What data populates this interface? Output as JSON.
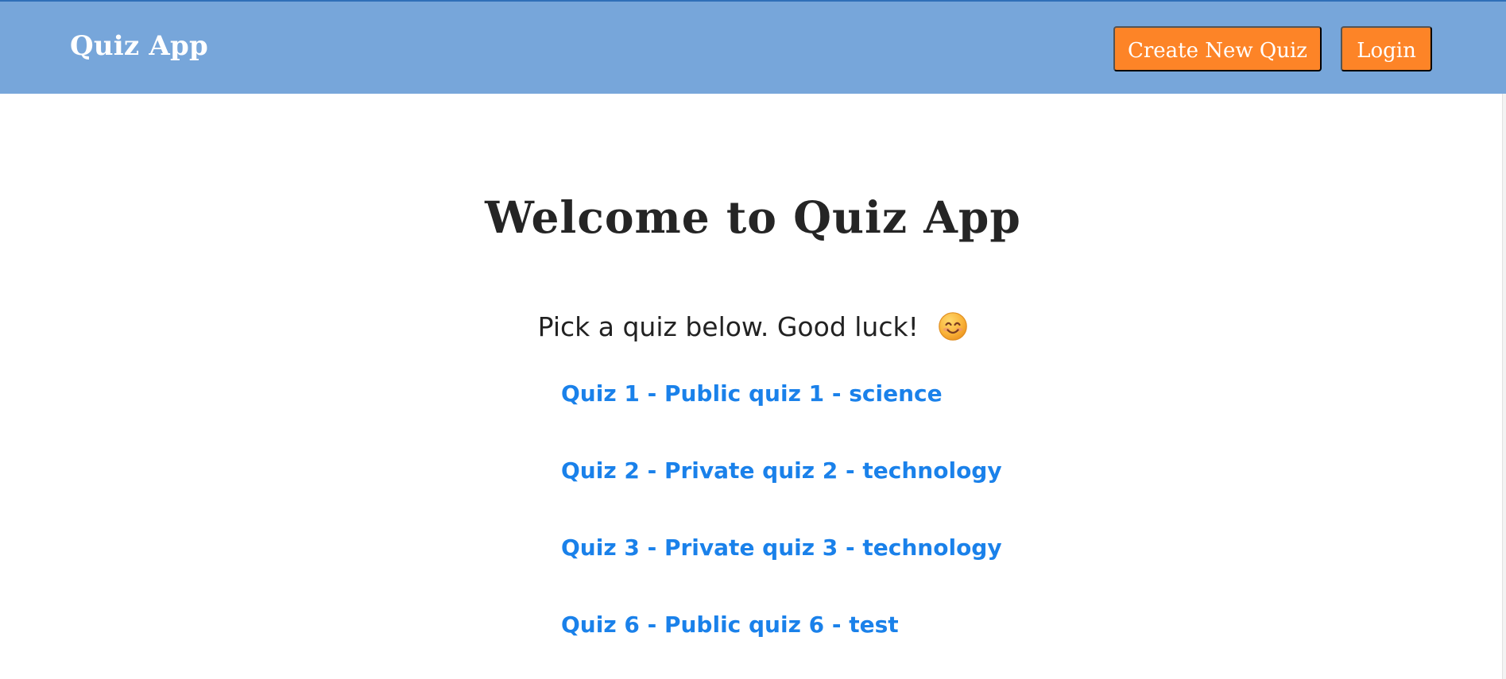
{
  "navbar": {
    "brand": "Quiz App",
    "buttons": {
      "create": "Create New Quiz",
      "login": "Login"
    }
  },
  "main": {
    "heading": "Welcome to Quiz App",
    "subtitle": "Pick a quiz below. Good luck!",
    "emoji_icon": "smiling-face-icon",
    "quizzes": [
      {
        "label": "Quiz 1 - Public quiz 1 - science"
      },
      {
        "label": "Quiz 2 - Private quiz 2 - technology"
      },
      {
        "label": "Quiz 3 - Private quiz 3 - technology"
      },
      {
        "label": "Quiz 6 - Public quiz 6 - test"
      }
    ]
  },
  "colors": {
    "navbar": "#77a6da",
    "button": "#fd8427",
    "link": "#1a81ea",
    "heading": "#252525"
  }
}
